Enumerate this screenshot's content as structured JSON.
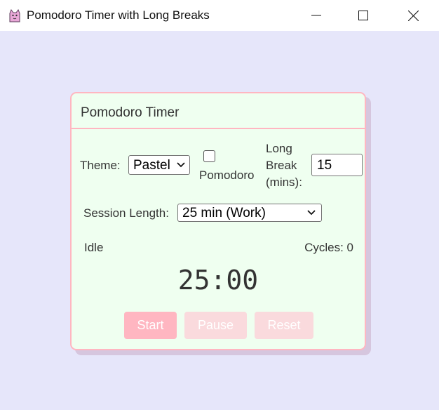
{
  "window": {
    "title": "Pomodoro Timer with Long Breaks",
    "app_icon": "cat-icon"
  },
  "card": {
    "title": "Pomodoro Timer"
  },
  "settings": {
    "theme_label": "Theme:",
    "theme_value": "Pastel",
    "pomodoro_label": "Pomodoro",
    "pomodoro_checked": false,
    "long_break_label_lines": [
      "Long",
      "Break",
      "(mins):"
    ],
    "long_break_value": "15",
    "session_length_label": "Session Length:",
    "session_length_value": "25 min (Work)"
  },
  "status": {
    "state": "Idle",
    "cycles": "Cycles: 0"
  },
  "timer": {
    "display": "25:00"
  },
  "controls": {
    "start": "Start",
    "pause": "Pause",
    "reset": "Reset"
  },
  "colors": {
    "background": "#e6e6fa",
    "card_bg": "#effff0",
    "accent_pink": "#ffb6c1",
    "disabled_pink": "#fadadd"
  }
}
